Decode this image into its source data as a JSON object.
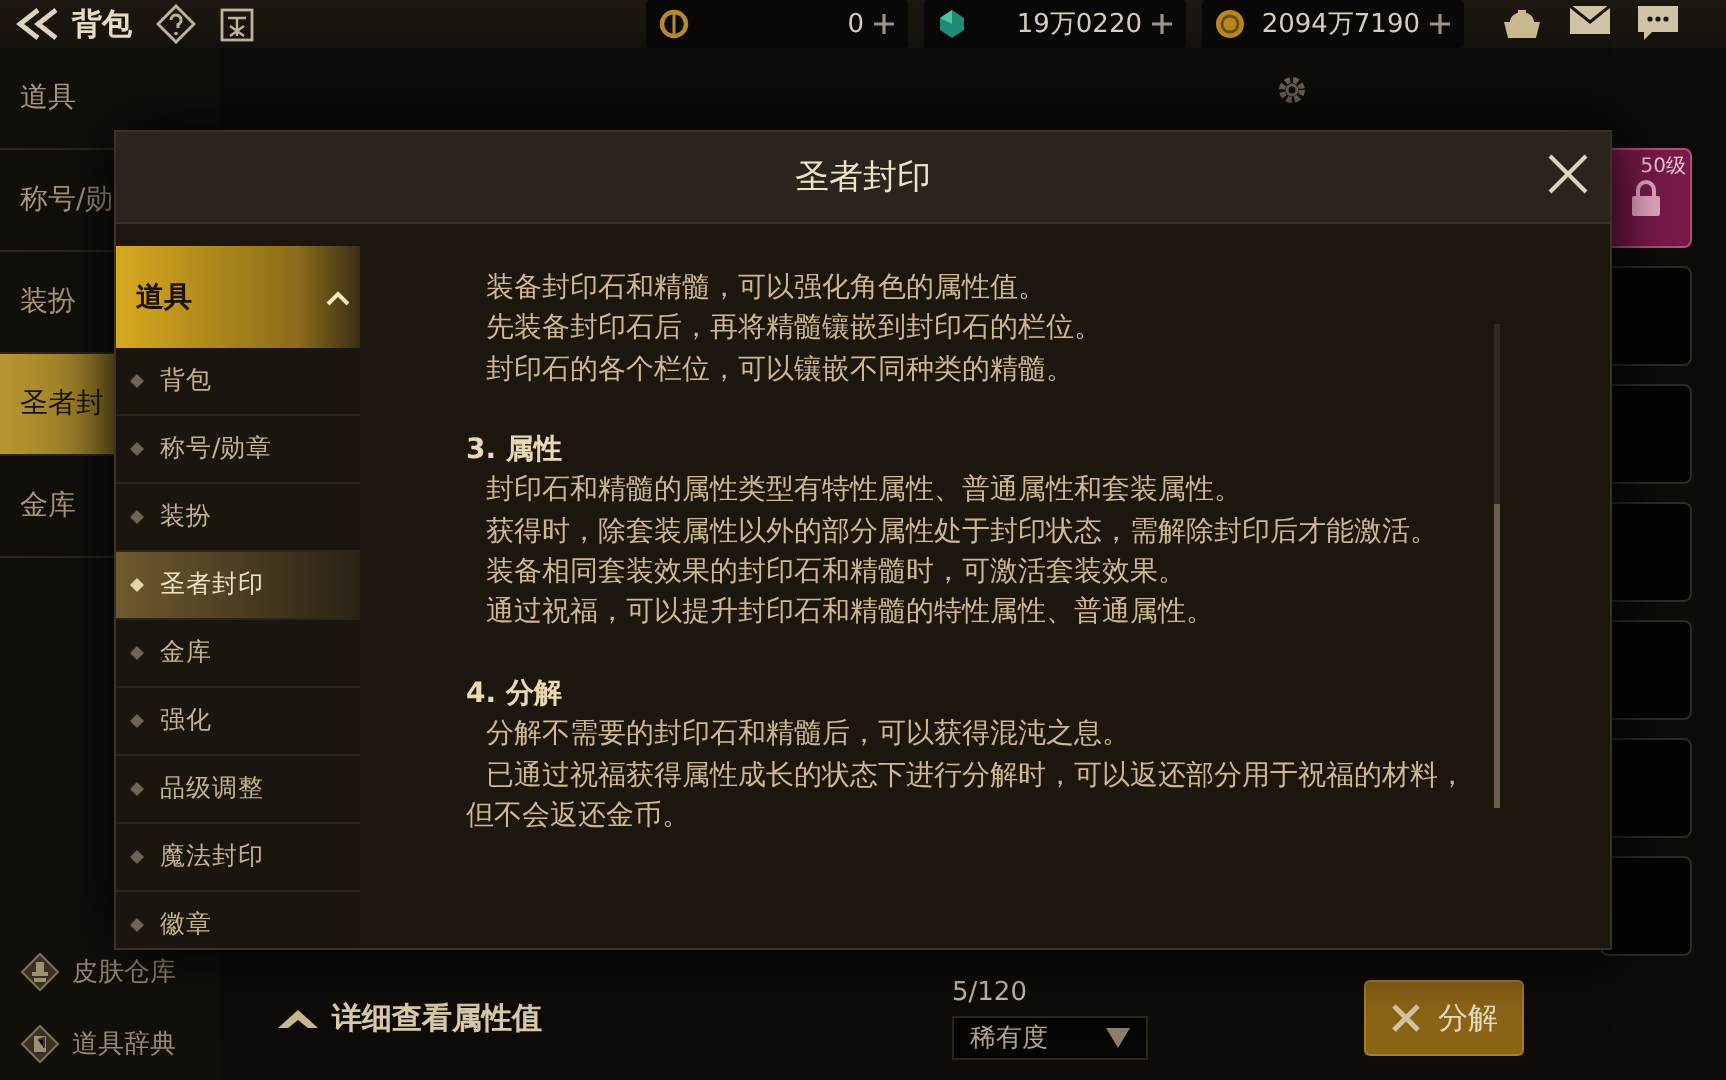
{
  "top_bar": {
    "title": "背包",
    "currencies": [
      {
        "kind": "crystal-coin",
        "amount": "0"
      },
      {
        "kind": "gem",
        "amount": "19万0220"
      },
      {
        "kind": "gold",
        "amount": "2094万7190"
      }
    ]
  },
  "sidebar": {
    "items": [
      {
        "label": "道具",
        "selected": false
      },
      {
        "label": "称号/勋",
        "selected": false
      },
      {
        "label": "装扮",
        "selected": false
      },
      {
        "label": "圣者封",
        "selected": true
      },
      {
        "label": "金库",
        "selected": false
      }
    ],
    "links": [
      {
        "kind": "skin",
        "label": "皮肤仓库"
      },
      {
        "kind": "dictionary",
        "label": "道具辞典"
      }
    ]
  },
  "slots": [
    {
      "kind": "locked",
      "label": "50级"
    },
    {
      "kind": "empty"
    },
    {
      "kind": "empty"
    },
    {
      "kind": "empty"
    },
    {
      "kind": "empty"
    },
    {
      "kind": "empty"
    },
    {
      "kind": "empty"
    }
  ],
  "bottom_bar": {
    "detail_link": "详细查看属性值",
    "count": "5/120",
    "sort": {
      "value": "稀有度"
    },
    "decompose_button": "分解"
  },
  "dialog": {
    "title": "圣者封印",
    "nav": {
      "header": "道具",
      "expanded": true,
      "items": [
        {
          "label": "背包",
          "selected": false
        },
        {
          "label": "称号/勋章",
          "selected": false
        },
        {
          "label": "装扮",
          "selected": false
        },
        {
          "label": "圣者封印",
          "selected": true
        },
        {
          "label": "金库",
          "selected": false
        },
        {
          "label": "强化",
          "selected": false
        },
        {
          "label": "品级调整",
          "selected": false
        },
        {
          "label": "魔法封印",
          "selected": false
        },
        {
          "label": "徽章",
          "selected": false
        }
      ]
    },
    "sections": [
      {
        "lines": [
          "装备封印石和精髓，可以强化角色的属性值。",
          "先装备封印石后，再将精髓镶嵌到封印石的栏位。",
          "封印石的各个栏位，可以镶嵌不同种类的精髓。"
        ]
      },
      {
        "heading": "3. 属性",
        "lines": [
          "封印石和精髓的属性类型有特性属性、普通属性和套装属性。",
          "获得时，除套装属性以外的部分属性处于封印状态，需解除封印后才能激活。",
          "装备相同套装效果的封印石和精髓时，可激活套装效果。",
          "通过祝福，可以提升封印石和精髓的特性属性、普通属性。"
        ]
      },
      {
        "heading": "4. 分解",
        "lines": [
          "分解不需要的封印石和精髓后，可以获得混沌之息。",
          "已通过祝福获得属性成长的状态下进行分解时，可以返还部分用于祝福的材料，但不会返还金币。"
        ]
      }
    ]
  }
}
